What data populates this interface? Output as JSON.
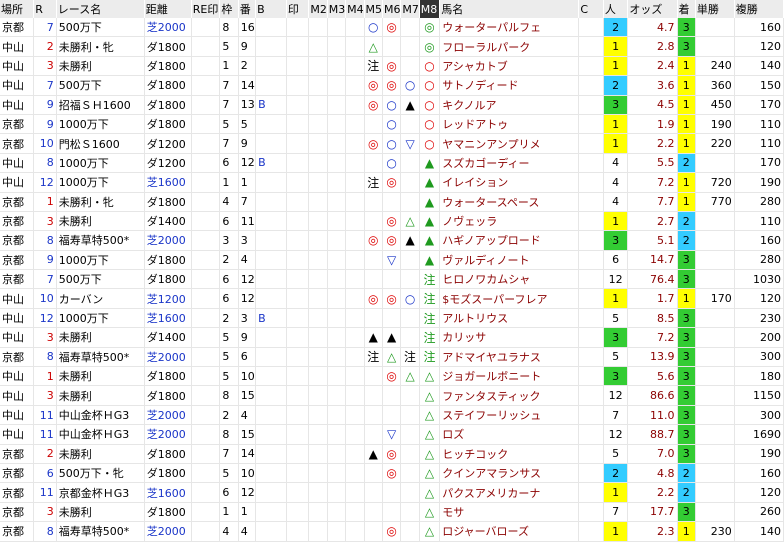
{
  "headers": [
    "場所",
    "R",
    "レース名",
    "距離",
    "RE印1",
    "枠",
    "番",
    "B",
    "印",
    "M2",
    "M3",
    "M4",
    "M5",
    "M6",
    "M7",
    "M8",
    "馬名",
    "C",
    "人",
    "オッズ",
    "着",
    "単勝",
    "複勝"
  ],
  "colors": {
    "red": "#cc0000",
    "blue": "#1a35c8",
    "yellow": "#ffff00",
    "green": "#33cc33",
    "cyan": "#33ccff"
  },
  "rows": [
    {
      "place": "京都",
      "r": "7",
      "race": "500万下",
      "dist": "芝2000",
      "waku": "8",
      "ban": "16",
      "b": "",
      "m5": "○",
      "m6": "◎",
      "m7": "",
      "m8": "◎",
      "horse": "ウォーターパルフェ",
      "c": "",
      "pop": "2",
      "odds": "4.7",
      "chaku": "3",
      "tan": "",
      "fuku": "160"
    },
    {
      "place": "中山",
      "r": "2",
      "race": "未勝利・牝",
      "dist": "ダ1800",
      "waku": "5",
      "ban": "9",
      "b": "",
      "m5": "△",
      "m6": "",
      "m7": "",
      "m8": "◎",
      "horse": "フローラルパーク",
      "c": "",
      "pop": "1",
      "odds": "2.8",
      "chaku": "3",
      "tan": "",
      "fuku": "120"
    },
    {
      "place": "中山",
      "r": "3",
      "race": "未勝利",
      "dist": "ダ1800",
      "waku": "1",
      "ban": "2",
      "b": "",
      "m5": "注",
      "m6": "◎",
      "m7": "",
      "m8": "○",
      "horse": "アシャカトブ",
      "c": "",
      "pop": "1",
      "odds": "2.4",
      "chaku": "1",
      "tan": "240",
      "fuku": "140"
    },
    {
      "place": "中山",
      "r": "7",
      "race": "500万下",
      "dist": "ダ1800",
      "waku": "7",
      "ban": "14",
      "b": "",
      "m5": "◎",
      "m6": "◎",
      "m7": "○",
      "m8": "○",
      "horse": "サトノディード",
      "c": "",
      "pop": "2",
      "odds": "3.6",
      "chaku": "1",
      "tan": "360",
      "fuku": "150"
    },
    {
      "place": "中山",
      "r": "9",
      "race": "招福ＳＨ1600",
      "dist": "ダ1800",
      "waku": "7",
      "ban": "13",
      "b": "B",
      "m5": "◎",
      "m6": "○",
      "m7": "▲",
      "m8": "○",
      "horse": "キクノルア",
      "c": "",
      "pop": "3",
      "odds": "4.5",
      "chaku": "1",
      "tan": "450",
      "fuku": "170"
    },
    {
      "place": "京都",
      "r": "9",
      "race": "1000万下",
      "dist": "ダ1800",
      "waku": "5",
      "ban": "5",
      "b": "",
      "m5": "",
      "m6": "○",
      "m7": "",
      "m8": "○",
      "horse": "レッドアトゥ",
      "c": "",
      "pop": "1",
      "odds": "1.9",
      "chaku": "1",
      "tan": "190",
      "fuku": "110"
    },
    {
      "place": "京都",
      "r": "10",
      "race": "門松Ｓ1600",
      "dist": "ダ1200",
      "waku": "7",
      "ban": "9",
      "b": "",
      "m5": "◎",
      "m6": "○",
      "m7": "▽",
      "m8": "○",
      "horse": "ヤマニンアンプリメ",
      "c": "",
      "pop": "1",
      "odds": "2.2",
      "chaku": "1",
      "tan": "220",
      "fuku": "110"
    },
    {
      "place": "中山",
      "r": "8",
      "race": "1000万下",
      "dist": "ダ1200",
      "waku": "6",
      "ban": "12",
      "b": "B",
      "m5": "",
      "m6": "○",
      "m7": "",
      "m8": "▲",
      "horse": "スズカゴーディー",
      "c": "",
      "pop": "4",
      "odds": "5.5",
      "chaku": "2",
      "tan": "",
      "fuku": "170"
    },
    {
      "place": "中山",
      "r": "12",
      "race": "1000万下",
      "dist": "芝1600",
      "waku": "1",
      "ban": "1",
      "b": "",
      "m5": "注",
      "m6": "◎",
      "m7": "",
      "m8": "▲",
      "horse": "イレイション",
      "c": "",
      "pop": "4",
      "odds": "7.2",
      "chaku": "1",
      "tan": "720",
      "fuku": "190"
    },
    {
      "place": "京都",
      "r": "1",
      "race": "未勝利・牝",
      "dist": "ダ1800",
      "waku": "4",
      "ban": "7",
      "b": "",
      "m5": "",
      "m6": "",
      "m7": "",
      "m8": "▲",
      "horse": "ウォータースペース",
      "c": "",
      "pop": "4",
      "odds": "7.7",
      "chaku": "1",
      "tan": "770",
      "fuku": "280"
    },
    {
      "place": "京都",
      "r": "3",
      "race": "未勝利",
      "dist": "ダ1400",
      "waku": "6",
      "ban": "11",
      "b": "",
      "m5": "",
      "m6": "◎",
      "m7": "△",
      "m8": "▲",
      "horse": "ノヴェッラ",
      "c": "",
      "pop": "1",
      "odds": "2.7",
      "chaku": "2",
      "tan": "",
      "fuku": "110"
    },
    {
      "place": "京都",
      "r": "8",
      "race": "福寿草特500*",
      "dist": "芝2000",
      "waku": "3",
      "ban": "3",
      "b": "",
      "m5": "◎",
      "m6": "◎",
      "m7": "▲",
      "m8": "▲",
      "horse": "ハギノアップロード",
      "c": "",
      "pop": "3",
      "odds": "5.1",
      "chaku": "2",
      "tan": "",
      "fuku": "160"
    },
    {
      "place": "京都",
      "r": "9",
      "race": "1000万下",
      "dist": "ダ1800",
      "waku": "2",
      "ban": "4",
      "b": "",
      "m5": "",
      "m6": "▽",
      "m7": "",
      "m8": "▲",
      "horse": "ヴァルディノート",
      "c": "",
      "pop": "6",
      "odds": "14.7",
      "chaku": "3",
      "tan": "",
      "fuku": "280"
    },
    {
      "place": "京都",
      "r": "7",
      "race": "500万下",
      "dist": "ダ1800",
      "waku": "6",
      "ban": "12",
      "b": "",
      "m5": "",
      "m6": "",
      "m7": "",
      "m8": "注",
      "horse": "ヒロノワカムシャ",
      "c": "",
      "pop": "12",
      "odds": "76.4",
      "chaku": "3",
      "tan": "",
      "fuku": "1030"
    },
    {
      "place": "中山",
      "r": "10",
      "race": "カーバン",
      "dist": "芝1200",
      "waku": "6",
      "ban": "12",
      "b": "",
      "m5": "◎",
      "m6": "◎",
      "m7": "○",
      "m8": "注",
      "horse": "$モズスーパーフレア",
      "c": "",
      "pop": "1",
      "odds": "1.7",
      "chaku": "1",
      "tan": "170",
      "fuku": "120"
    },
    {
      "place": "中山",
      "r": "12",
      "race": "1000万下",
      "dist": "芝1600",
      "waku": "2",
      "ban": "3",
      "b": "B",
      "m5": "",
      "m6": "",
      "m7": "",
      "m8": "注",
      "horse": "アルトリウス",
      "c": "",
      "pop": "5",
      "odds": "8.5",
      "chaku": "3",
      "tan": "",
      "fuku": "230"
    },
    {
      "place": "中山",
      "r": "3",
      "race": "未勝利",
      "dist": "ダ1400",
      "waku": "5",
      "ban": "9",
      "b": "",
      "m5": "▲",
      "m6": "▲",
      "m7": "",
      "m8": "注",
      "horse": "カリッサ",
      "c": "",
      "pop": "3",
      "odds": "7.2",
      "chaku": "3",
      "tan": "",
      "fuku": "200"
    },
    {
      "place": "京都",
      "r": "8",
      "race": "福寿草特500*",
      "dist": "芝2000",
      "waku": "5",
      "ban": "6",
      "b": "",
      "m5": "注",
      "m6": "△",
      "m7": "注",
      "m8": "注",
      "horse": "アドマイヤユラナス",
      "c": "",
      "pop": "5",
      "odds": "13.9",
      "chaku": "3",
      "tan": "",
      "fuku": "300"
    },
    {
      "place": "中山",
      "r": "1",
      "race": "未勝利",
      "dist": "ダ1800",
      "waku": "5",
      "ban": "10",
      "b": "",
      "m5": "",
      "m6": "◎",
      "m7": "△",
      "m8": "△",
      "horse": "ジョガールボニート",
      "c": "",
      "pop": "3",
      "odds": "5.6",
      "chaku": "3",
      "tan": "",
      "fuku": "180"
    },
    {
      "place": "中山",
      "r": "3",
      "race": "未勝利",
      "dist": "ダ1800",
      "waku": "8",
      "ban": "15",
      "b": "",
      "m5": "",
      "m6": "",
      "m7": "",
      "m8": "△",
      "horse": "ファンタスティック",
      "c": "",
      "pop": "12",
      "odds": "86.6",
      "chaku": "3",
      "tan": "",
      "fuku": "1150"
    },
    {
      "place": "中山",
      "r": "11",
      "race": "中山金杯ＨG3",
      "dist": "芝2000",
      "waku": "2",
      "ban": "4",
      "b": "",
      "m5": "",
      "m6": "",
      "m7": "",
      "m8": "△",
      "horse": "ステイフーリッシュ",
      "c": "",
      "pop": "7",
      "odds": "11.0",
      "chaku": "3",
      "tan": "",
      "fuku": "300"
    },
    {
      "place": "中山",
      "r": "11",
      "race": "中山金杯ＨG3",
      "dist": "芝2000",
      "waku": "8",
      "ban": "15",
      "b": "",
      "m5": "",
      "m6": "▽",
      "m7": "",
      "m8": "△",
      "horse": "ロズ",
      "c": "",
      "pop": "12",
      "odds": "88.7",
      "chaku": "3",
      "tan": "",
      "fuku": "1690"
    },
    {
      "place": "京都",
      "r": "2",
      "race": "未勝利",
      "dist": "ダ1800",
      "waku": "7",
      "ban": "14",
      "b": "",
      "m5": "▲",
      "m6": "◎",
      "m7": "",
      "m8": "△",
      "horse": "ヒッチコック",
      "c": "",
      "pop": "5",
      "odds": "7.0",
      "chaku": "3",
      "tan": "",
      "fuku": "190"
    },
    {
      "place": "京都",
      "r": "6",
      "race": "500万下・牝",
      "dist": "ダ1800",
      "waku": "5",
      "ban": "10",
      "b": "",
      "m5": "",
      "m6": "◎",
      "m7": "",
      "m8": "△",
      "horse": "クインアマランサス",
      "c": "",
      "pop": "2",
      "odds": "4.8",
      "chaku": "2",
      "tan": "",
      "fuku": "160"
    },
    {
      "place": "京都",
      "r": "11",
      "race": "京都金杯ＨG3",
      "dist": "芝1600",
      "waku": "6",
      "ban": "12",
      "b": "",
      "m5": "",
      "m6": "",
      "m7": "",
      "m8": "△",
      "horse": "パクスアメリカーナ",
      "c": "",
      "pop": "1",
      "odds": "2.2",
      "chaku": "2",
      "tan": "",
      "fuku": "120"
    },
    {
      "place": "京都",
      "r": "3",
      "race": "未勝利",
      "dist": "ダ1800",
      "waku": "1",
      "ban": "1",
      "b": "",
      "m5": "",
      "m6": "",
      "m7": "",
      "m8": "△",
      "horse": "モサ",
      "c": "",
      "pop": "7",
      "odds": "17.7",
      "chaku": "3",
      "tan": "",
      "fuku": "260"
    },
    {
      "place": "京都",
      "r": "8",
      "race": "福寿草特500*",
      "dist": "芝2000",
      "waku": "4",
      "ban": "4",
      "b": "",
      "m5": "",
      "m6": "◎",
      "m7": "",
      "m8": "△",
      "horse": "ロジャーバローズ",
      "c": "",
      "pop": "1",
      "odds": "2.3",
      "chaku": "1",
      "tan": "230",
      "fuku": "140"
    }
  ]
}
